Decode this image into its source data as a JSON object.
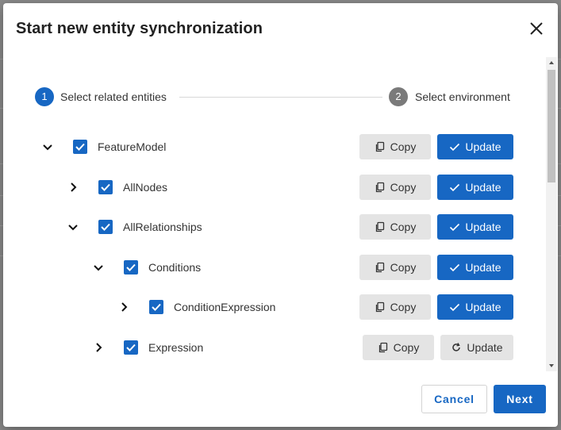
{
  "dialog": {
    "title": "Start new entity synchronization",
    "cancel_label": "Cancel",
    "next_label": "Next"
  },
  "stepper": {
    "steps": [
      {
        "number": "1",
        "label": "Select related entities",
        "state": "active"
      },
      {
        "number": "2",
        "label": "Select environment",
        "state": "inactive"
      }
    ]
  },
  "tree": {
    "copy_label": "Copy",
    "update_label": "Update",
    "rows": [
      {
        "label": "FeatureModel",
        "expanded": true,
        "checked": true,
        "update_active": true
      },
      {
        "label": "AllNodes",
        "expanded": false,
        "checked": true,
        "update_active": true
      },
      {
        "label": "AllRelationships",
        "expanded": true,
        "checked": true,
        "update_active": true
      },
      {
        "label": "Conditions",
        "expanded": true,
        "checked": true,
        "update_active": true
      },
      {
        "label": "ConditionExpression",
        "expanded": false,
        "checked": true,
        "update_active": true
      },
      {
        "label": "Expression",
        "expanded": false,
        "checked": true,
        "update_active": false
      }
    ]
  },
  "colors": {
    "primary": "#1767c3",
    "secondary_button": "#e4e4e4",
    "inactive_step": "#7a7a7a"
  }
}
